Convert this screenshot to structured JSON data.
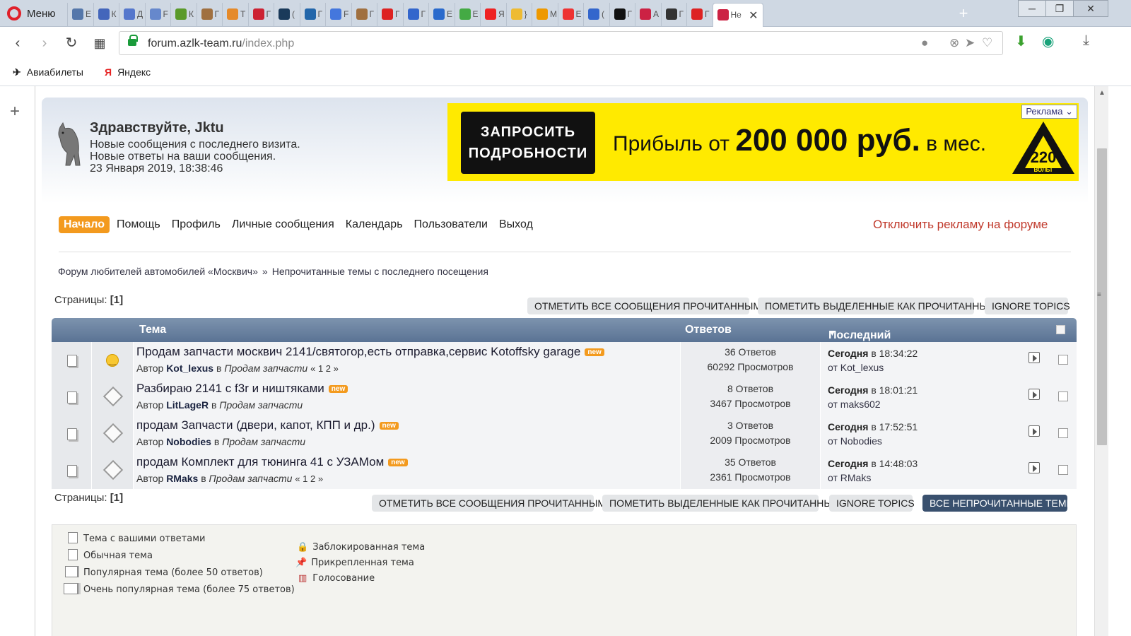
{
  "browser": {
    "menu_label": "Меню",
    "tabs": [
      {
        "label": "Е",
        "color": "#5577aa"
      },
      {
        "label": "К",
        "color": "#4466bb"
      },
      {
        "label": "Д",
        "color": "#5577cc"
      },
      {
        "label": "F",
        "color": "#6688cc"
      },
      {
        "label": "К",
        "color": "#5a9a2a"
      },
      {
        "label": "Г",
        "color": "#a07040"
      },
      {
        "label": "Т",
        "color": "#e58a2a"
      },
      {
        "label": "Г",
        "color": "#cc2233"
      },
      {
        "label": "(",
        "color": "#1a3a5a"
      },
      {
        "label": "Г",
        "color": "#2266aa"
      },
      {
        "label": "F",
        "color": "#4477dd"
      },
      {
        "label": "Г",
        "color": "#a07040"
      },
      {
        "label": "Г",
        "color": "#dd2222"
      },
      {
        "label": "Г",
        "color": "#3366cc"
      },
      {
        "label": "Е",
        "color": "#2a6acc"
      },
      {
        "label": "Е",
        "color": "#44aa44"
      },
      {
        "label": "Я",
        "color": "#ee2222"
      },
      {
        "label": "}",
        "color": "#eebb33"
      },
      {
        "label": "М",
        "color": "#ee9900"
      },
      {
        "label": "Е",
        "color": "#ee3333"
      },
      {
        "label": "(",
        "color": "#3366cc"
      },
      {
        "label": "Г",
        "color": "#111111"
      },
      {
        "label": "А",
        "color": "#cc2244"
      },
      {
        "label": "Г",
        "color": "#333333"
      },
      {
        "label": "Г",
        "color": "#dd2222"
      }
    ],
    "active_tab": {
      "label": "Не",
      "color": "#cc2244"
    },
    "new_tab": "+",
    "url_host": "forum.azlk-team.ru",
    "url_path": "/index.php",
    "bookmarks": [
      {
        "icon": "✈",
        "label": "Авиабилеты"
      },
      {
        "icon": "Я",
        "label": "Яндекс"
      }
    ]
  },
  "header": {
    "greeting": "Здравствуйте, Jktu",
    "lines": [
      "Новые сообщения с последнего визита.",
      "Новые ответы на ваши сообщения.",
      "23 Января 2019, 18:38:46"
    ]
  },
  "ad": {
    "button_lines": [
      "ЗАПРОСИТЬ",
      "ПОДРОБНОСТИ"
    ],
    "text_pre": "Прибыль от",
    "text_amount": "200 000 руб.",
    "text_post": "в мес.",
    "label": "Реклама",
    "logo_number": "220",
    "logo_word": "ВОЛЬТ"
  },
  "menu": [
    "Начало",
    "Помощь",
    "Профиль",
    "Личные сообщения",
    "Календарь",
    "Пользователи",
    "Выход"
  ],
  "disable_ads": "Отключить рекламу на форуме",
  "breadcrumbs": [
    "Форум любителей автомобилей «Москвич»",
    "»",
    "Непрочитанные темы с последнего посещения"
  ],
  "pages_label": "Страницы:",
  "pages_value": "[1]",
  "buttons": {
    "mark_all": "ОТМЕТИТЬ ВСЕ СООБЩЕНИЯ ПРОЧИТАННЫМИ",
    "mark_selected": "ПОМЕТИТЬ ВЫДЕЛЕННЫЕ КАК ПРОЧИТАННЫЕ",
    "ignore": "IGNORE TOPICS",
    "all_unread": "ВСЕ НЕПРОЧИТАННЫЕ ТЕМЫ"
  },
  "table": {
    "col_topic": "Тема",
    "col_replies": "Ответов",
    "col_last": "Последний ответ",
    "new_badge": "new",
    "author_prefix": "Автор",
    "in_word": "в",
    "by_word": "от",
    "rows": [
      {
        "icon": "smile",
        "title": "Продам запчасти москвич 2141/святогор,есть отправка,сервис Kotoffsky garage",
        "author": "Kot_lexus",
        "board": "Продам запчасти",
        "pages": "« 1 2 »",
        "replies": "36 Ответов",
        "views": "60292 Просмотров",
        "last_day": "Сегодня",
        "last_time": "в 18:34:22",
        "last_by": "Kot_lexus"
      },
      {
        "icon": "diamond",
        "title": "Разбираю 2141 с f3r и ништяками",
        "author": "LitLageR",
        "board": "Продам запчасти",
        "pages": "",
        "replies": "8 Ответов",
        "views": "3467 Просмотров",
        "last_day": "Сегодня",
        "last_time": "в 18:01:21",
        "last_by": "maks602"
      },
      {
        "icon": "diamond",
        "title": "продам Запчасти (двери, капот, КПП и др.)",
        "author": "Nobodies",
        "board": "Продам запчасти",
        "pages": "",
        "replies": "3 Ответов",
        "views": "2009 Просмотров",
        "last_day": "Сегодня",
        "last_time": "в 17:52:51",
        "last_by": "Nobodies"
      },
      {
        "icon": "diamond",
        "title": "продам Комплект для тюнинга 41 с УЗАМом",
        "author": "RMaks",
        "board": "Продам запчасти",
        "pages": "« 1 2 »",
        "replies": "35 Ответов",
        "views": "2361 Просмотров",
        "last_day": "Сегодня",
        "last_time": "в 14:48:03",
        "last_by": "RMaks"
      }
    ]
  },
  "legend": {
    "left": [
      "Тема с вашими ответами",
      "Обычная тема",
      "Популярная тема (более 50 ответов)",
      "Очень популярная тема (более 75 ответов)"
    ],
    "right": [
      "Заблокированная тема",
      "Прикрепленная тема",
      "Голосование"
    ]
  }
}
